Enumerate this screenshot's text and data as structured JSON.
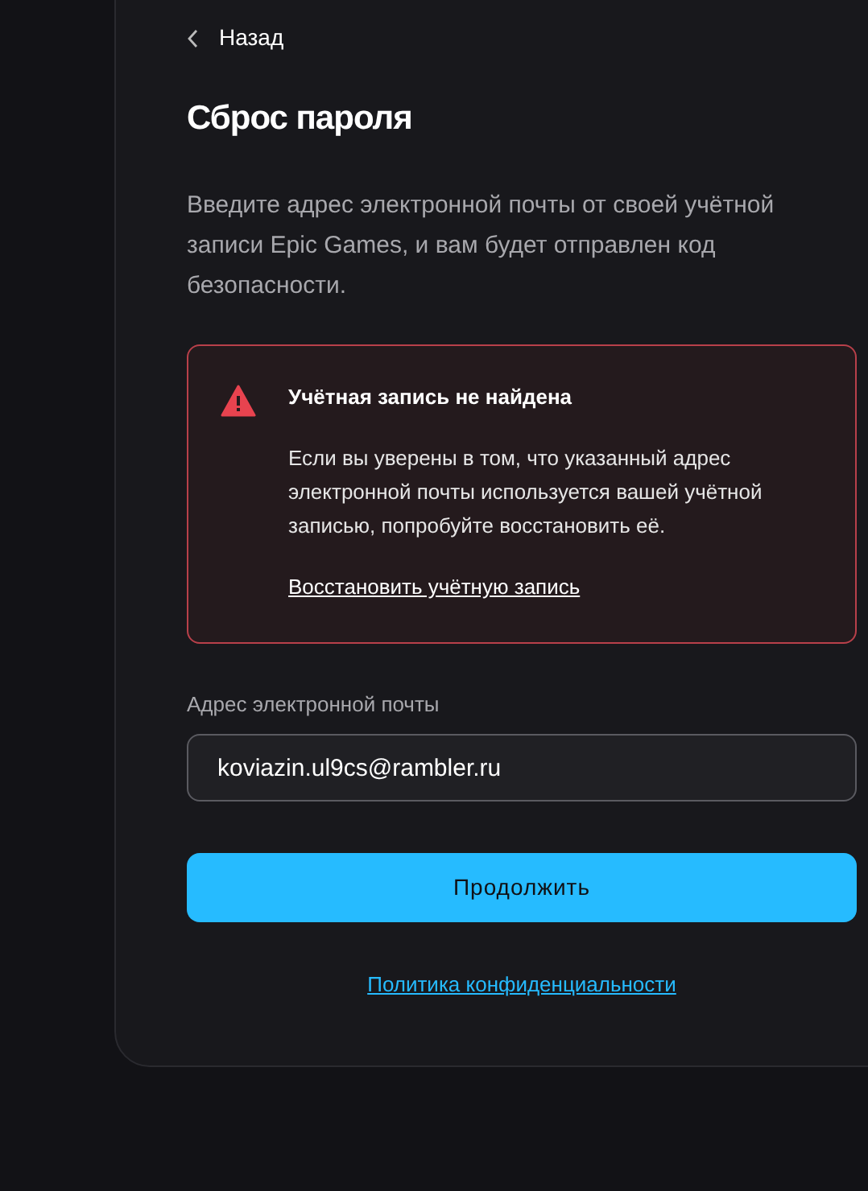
{
  "back_link": {
    "label": "Назад"
  },
  "title": "Сброс пароля",
  "description": "Введите адрес электронной почты от своей учётной записи Epic Games, и вам будет отправлен код безопасности.",
  "alert": {
    "kind": "error",
    "title": "Учётная запись не найдена",
    "message": "Если вы уверены в том, что указанный адрес электронной почты используется вашей учётной записью, попробуйте восстановить её.",
    "link": "Восстановить учётную запись"
  },
  "email_field": {
    "label": "Адрес электронной почты",
    "value": "koviazin.ul9cs@rambler.ru"
  },
  "submit_button": {
    "label": "Продолжить"
  },
  "privacy_link": "Политика конфиденциальности"
}
